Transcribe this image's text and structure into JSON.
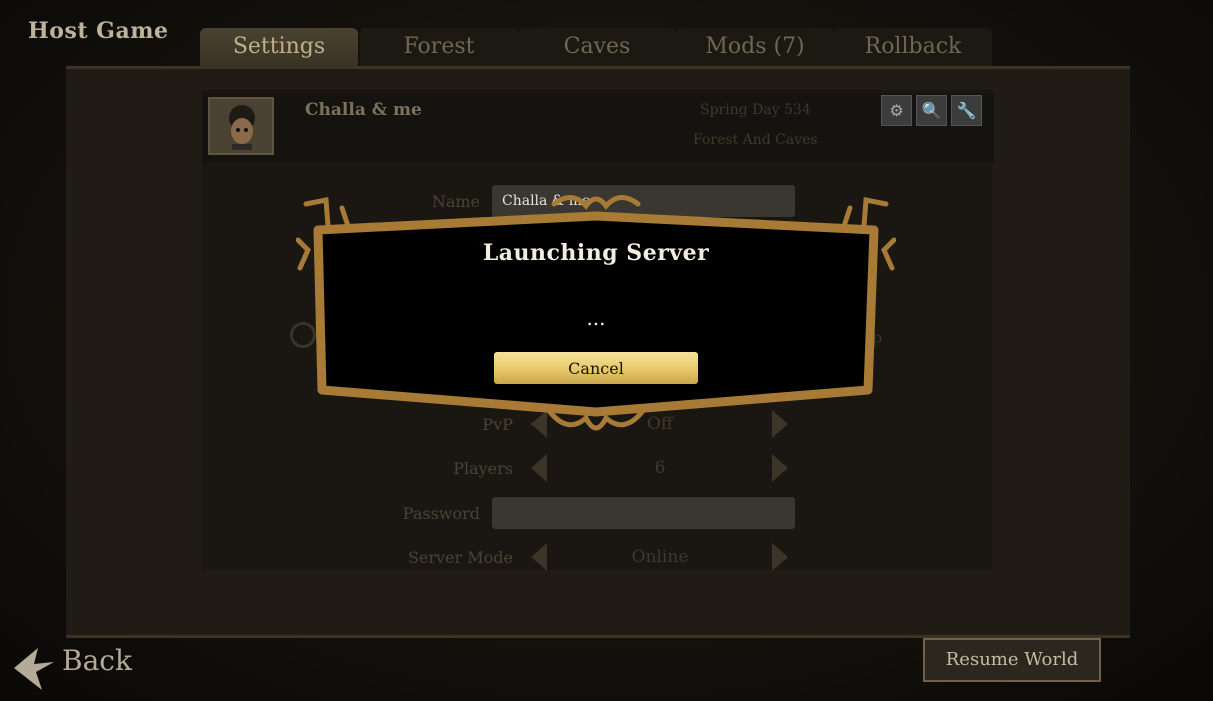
{
  "header": {
    "title": "Host Game"
  },
  "tabs": [
    {
      "label": "Settings",
      "active": true
    },
    {
      "label": "Forest",
      "active": false
    },
    {
      "label": "Caves",
      "active": false
    },
    {
      "label": "Mods (7)",
      "active": false
    },
    {
      "label": "Rollback",
      "active": false
    }
  ],
  "world": {
    "name": "Challa & me",
    "day": "Spring Day 534",
    "mode": "Forest And Caves",
    "icons": [
      "server-settings-icon",
      "magnifier-icon",
      "wrench-icon"
    ]
  },
  "settings": {
    "name_label": "Name",
    "name_value": "Challa & me",
    "pvp_label": "PvP",
    "pvp_value": "Off",
    "players_label": "Players",
    "players_value": "6",
    "password_label": "Password",
    "password_value": "",
    "server_mode_label": "Server Mode",
    "server_mode_value": "Online",
    "partial_label": "p"
  },
  "dialog": {
    "title": "Launching Server",
    "body": "...",
    "cancel_label": "Cancel"
  },
  "footer": {
    "back_label": "Back",
    "resume_label": "Resume World"
  },
  "colors": {
    "accent_gold": "#e6c86a",
    "frame_brown": "#a77a36",
    "dialog_bg": "#000000"
  }
}
